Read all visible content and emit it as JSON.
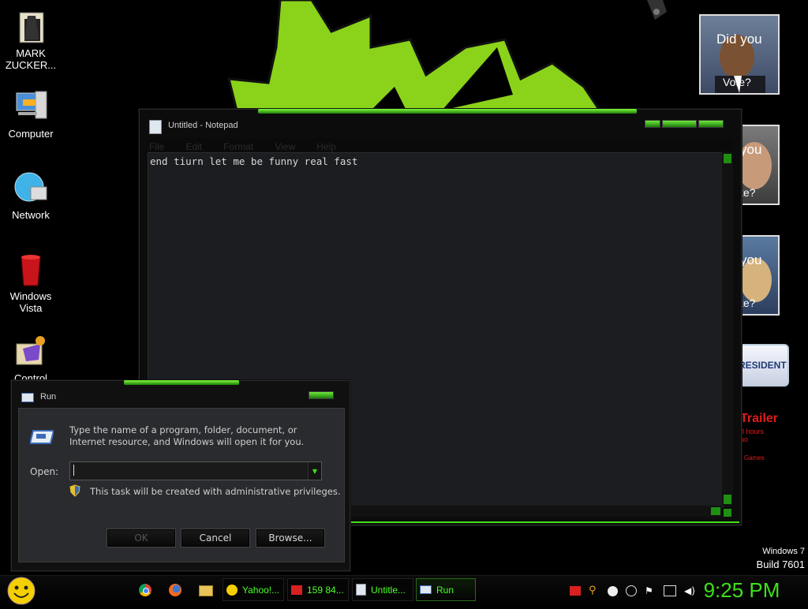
{
  "desktop": {
    "icons": [
      {
        "label": "MARK\nZUCKER...",
        "icon": "folder-icon"
      },
      {
        "label": "Computer",
        "icon": "computer-icon"
      },
      {
        "label": "Network",
        "icon": "network-icon"
      },
      {
        "label": "Windows\nVista",
        "icon": "recycle-bin-icon"
      },
      {
        "label": "Control",
        "icon": "control-panel-icon"
      }
    ],
    "gadgets": {
      "obama_caption_top": "Did you",
      "obama_caption_bottom": "Vote?",
      "gadget2_top": "you",
      "gadget2_bottom": "te?",
      "gadget3_top": "you",
      "gadget3_bottom": "te?",
      "president_banner": "RESIDENT",
      "trailer_title": "Trailer",
      "trailer_line1": "8 hours",
      "trailer_line2": "ao",
      "trailer_line3": "r Games"
    },
    "watermark_line1": "Windows 7",
    "watermark_line2": "Build 7601"
  },
  "notepad": {
    "title": "Untitled - Notepad",
    "menu": [
      "File",
      "Edit",
      "Format",
      "View",
      "Help"
    ],
    "content": "end tiurn let me be funny real fast"
  },
  "run_dialog": {
    "title": "Run",
    "description": "Type the name of a program, folder, document, or Internet resource, and Windows will open it for you.",
    "open_label": "Open:",
    "open_value": "",
    "admin_note": "This task will be created with administrative privileges.",
    "ok_label": "OK",
    "cancel_label": "Cancel",
    "browse_label": "Browse..."
  },
  "taskbar": {
    "items": [
      {
        "label": "Yahoo!...",
        "icon": "yahoo-messenger-icon"
      },
      {
        "label": "159 84...",
        "icon": "media-icon"
      },
      {
        "label": "Untitle...",
        "icon": "notepad-icon"
      },
      {
        "label": "Run",
        "icon": "run-icon"
      }
    ],
    "clock": "9:25 PM"
  }
}
